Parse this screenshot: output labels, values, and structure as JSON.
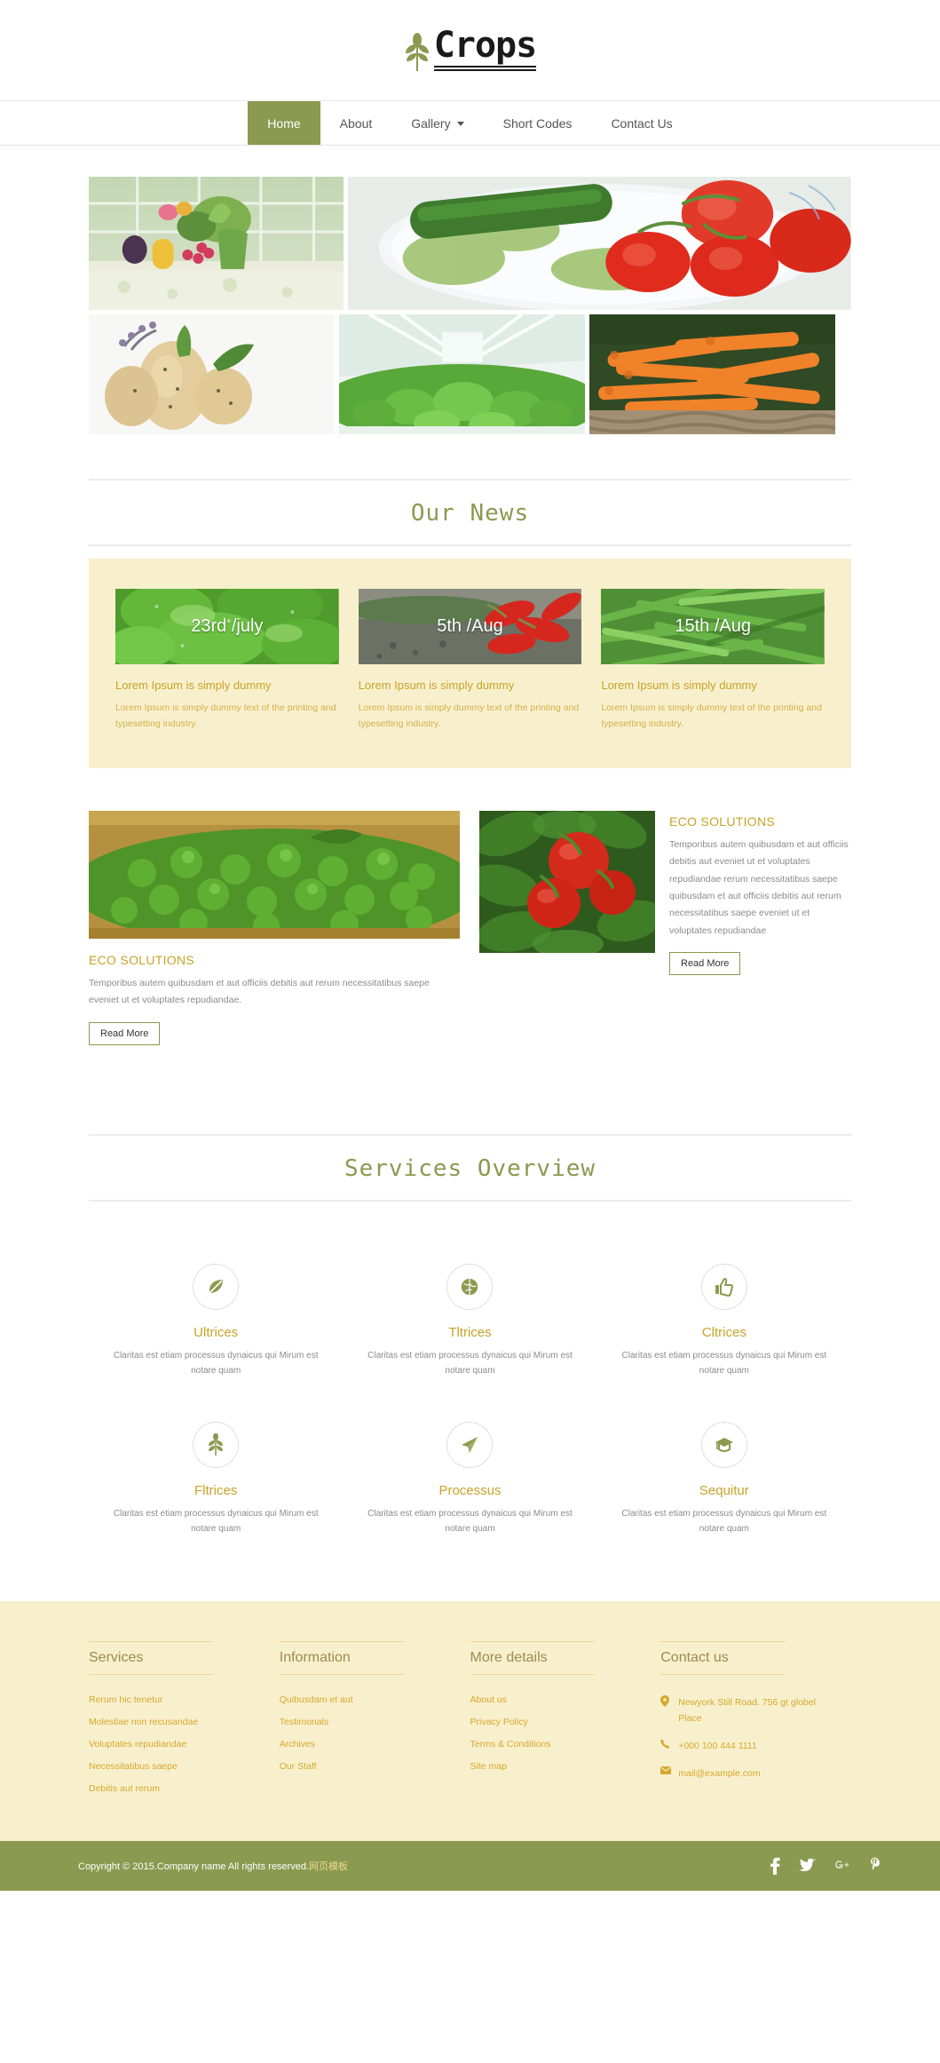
{
  "header": {
    "logo_text": "Crops",
    "logo_icon": "wheat-leaf-icon"
  },
  "nav": {
    "items": [
      {
        "label": "Home",
        "active": true,
        "dropdown": false
      },
      {
        "label": "About",
        "active": false,
        "dropdown": false
      },
      {
        "label": "Gallery",
        "active": false,
        "dropdown": true
      },
      {
        "label": "Short Codes",
        "active": false,
        "dropdown": false
      },
      {
        "label": "Contact Us",
        "active": false,
        "dropdown": false
      }
    ]
  },
  "gallery": {
    "images": [
      {
        "alt": "vegetables-flowers-on-table",
        "name": "gallery-image-1"
      },
      {
        "alt": "tomatoes-cucumber-on-plate",
        "name": "gallery-image-2"
      },
      {
        "alt": "potatoes",
        "name": "gallery-image-3"
      },
      {
        "alt": "greenhouse-lettuce",
        "name": "gallery-image-4"
      },
      {
        "alt": "carrots-in-basket",
        "name": "gallery-image-5"
      }
    ]
  },
  "news": {
    "section_title": "Our News",
    "cards": [
      {
        "date": "23rd /july",
        "title": "Lorem Ipsum is simply dummy",
        "body": "Lorem Ipsum is simply dummy text of the printing and typesetting industry.",
        "image": "lettuce-leaves"
      },
      {
        "date": "5th /Aug",
        "title": "Lorem Ipsum is simply dummy",
        "body": "Lorem Ipsum is simply dummy text of the printing and typesetting industry.",
        "image": "red-chilies"
      },
      {
        "date": "15th /Aug",
        "title": "Lorem Ipsum is simply dummy",
        "body": "Lorem Ipsum is simply dummy text of the printing and typesetting industry.",
        "image": "green-beans"
      }
    ]
  },
  "eco": {
    "left": {
      "title": "ECO SOLUTIONS",
      "body": "Temporibus autem quibusdam et aut officiis debitis aut rerum necessitatibus saepe eveniet ut et voluptates repudiandae.",
      "button": "Read More",
      "image": "green-peas"
    },
    "right": {
      "title": "ECO SOLUTIONS",
      "body": "Temporibus autem quibusdam et aut officiis debitis aut eveniet ut et voluptates repudiandae rerum necessitatibus saepe quibusdam et aut officiis debitis aut rerum necessitatibus saepe eveniet ut et voluptates repudiandae",
      "button": "Read More",
      "image": "tomatoes-on-vine"
    }
  },
  "services": {
    "section_title": "Services Overview",
    "items": [
      {
        "icon": "leaf-icon",
        "title": "Ultrices",
        "desc": "Claritas est etiam processus dynaicus qui Mirum est notare quam"
      },
      {
        "icon": "globe-icon",
        "title": "Tltrices",
        "desc": "Claritas est etiam processus dynaicus qui Mirum est notare quam"
      },
      {
        "icon": "thumbs-up-icon",
        "title": "Cltrices",
        "desc": "Claritas est etiam processus dynaicus qui Mirum est notare quam"
      },
      {
        "icon": "wheat-icon",
        "title": "Fltrices",
        "desc": "Claritas est etiam processus dynaicus qui Mirum est notare quam"
      },
      {
        "icon": "paper-plane-icon",
        "title": "Processus",
        "desc": "Claritas est etiam processus dynaicus qui Mirum est notare quam"
      },
      {
        "icon": "graduation-cap-icon",
        "title": "Sequitur",
        "desc": "Claritas est etiam processus dynaicus qui Mirum est notare quam"
      }
    ]
  },
  "footer": {
    "columns": [
      {
        "heading": "Services",
        "links": [
          "Rerum hic tenetur",
          "Molestiae non recusandae",
          "Voluptates repudiandae",
          "Necessitatibus saepe",
          "Debitis aut rerum"
        ]
      },
      {
        "heading": "Information",
        "links": [
          "Quibusdam et aut",
          "Testimonals",
          "Archives",
          "Our Staff"
        ]
      },
      {
        "heading": "More details",
        "links": [
          "About us",
          "Privacy Policy",
          "Terms & Conditions",
          "Site map"
        ]
      }
    ],
    "contact": {
      "heading": "Contact us",
      "rows": [
        {
          "icon": "map-pin-icon",
          "text": "Newyork Still Road. 756 gt globel Place"
        },
        {
          "icon": "phone-icon",
          "text": "+000 100 444 1111"
        },
        {
          "icon": "envelope-icon",
          "text": "mail@example.com"
        }
      ]
    }
  },
  "copyright": {
    "text": "Copyright © 2015.Company name All rights reserved.",
    "link_text": "网页模板",
    "socials": [
      {
        "name": "facebook-icon",
        "label": "f"
      },
      {
        "name": "twitter-icon",
        "label": "t"
      },
      {
        "name": "google-plus-icon",
        "label": "g+"
      },
      {
        "name": "pinterest-icon",
        "label": "p"
      }
    ]
  },
  "colors": {
    "olive": "#8a9a50",
    "cream": "#f8f0cd",
    "gold": "#c9a227",
    "gold_link": "#d6a82c"
  }
}
